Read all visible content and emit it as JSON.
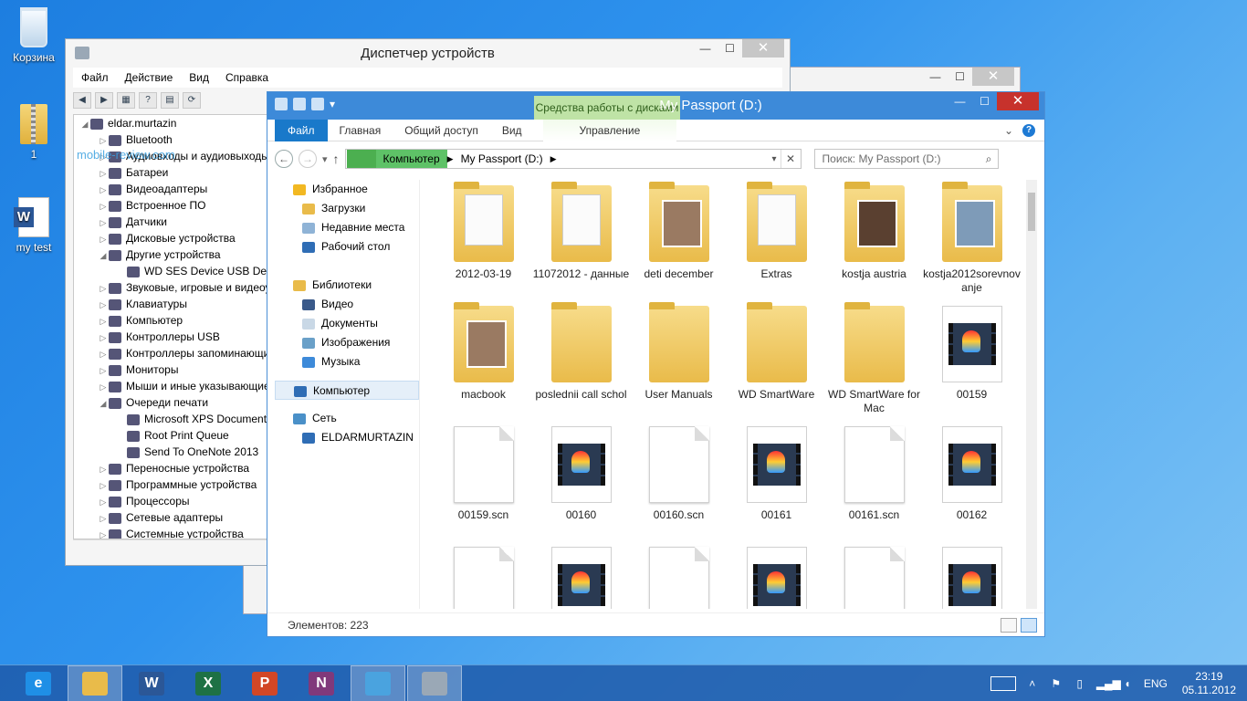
{
  "desktop": {
    "icons": [
      {
        "label": "Корзина"
      },
      {
        "label": "1"
      },
      {
        "label": "my test"
      }
    ]
  },
  "device_manager": {
    "title": "Диспетчер устройств",
    "menu": [
      "Файл",
      "Действие",
      "Вид",
      "Справка"
    ],
    "watermark": "mobile-review.com",
    "tree": [
      {
        "label": "eldar.murtazin",
        "level": 0,
        "expand": "◢"
      },
      {
        "label": "Bluetooth",
        "level": 1,
        "expand": "▷"
      },
      {
        "label": "Аудиовходы и аудиовыходы",
        "level": 1,
        "expand": "▷"
      },
      {
        "label": "Батареи",
        "level": 1,
        "expand": "▷"
      },
      {
        "label": "Видеоадаптеры",
        "level": 1,
        "expand": "▷"
      },
      {
        "label": "Встроенное ПО",
        "level": 1,
        "expand": "▷"
      },
      {
        "label": "Датчики",
        "level": 1,
        "expand": "▷"
      },
      {
        "label": "Дисковые устройства",
        "level": 1,
        "expand": "▷"
      },
      {
        "label": "Другие устройства",
        "level": 1,
        "expand": "◢"
      },
      {
        "label": "WD SES Device USB Device",
        "level": 2,
        "expand": ""
      },
      {
        "label": "Звуковые, игровые и видеоустройства",
        "level": 1,
        "expand": "▷"
      },
      {
        "label": "Клавиатуры",
        "level": 1,
        "expand": "▷"
      },
      {
        "label": "Компьютер",
        "level": 1,
        "expand": "▷"
      },
      {
        "label": "Контроллеры USB",
        "level": 1,
        "expand": "▷"
      },
      {
        "label": "Контроллеры запоминающих устройств",
        "level": 1,
        "expand": "▷"
      },
      {
        "label": "Мониторы",
        "level": 1,
        "expand": "▷"
      },
      {
        "label": "Мыши и иные указывающие устройства",
        "level": 1,
        "expand": "▷"
      },
      {
        "label": "Очереди печати",
        "level": 1,
        "expand": "◢"
      },
      {
        "label": "Microsoft XPS Document Writer",
        "level": 2,
        "expand": ""
      },
      {
        "label": "Root Print Queue",
        "level": 2,
        "expand": ""
      },
      {
        "label": "Send To OneNote 2013",
        "level": 2,
        "expand": ""
      },
      {
        "label": "Переносные устройства",
        "level": 1,
        "expand": "▷"
      },
      {
        "label": "Программные устройства",
        "level": 1,
        "expand": "▷"
      },
      {
        "label": "Процессоры",
        "level": 1,
        "expand": "▷"
      },
      {
        "label": "Сетевые адаптеры",
        "level": 1,
        "expand": "▷"
      },
      {
        "label": "Системные устройства",
        "level": 1,
        "expand": "▷"
      }
    ]
  },
  "explorer": {
    "title": "My Passport (D:)",
    "context_group": "Средства работы с дисками",
    "ribbon_tabs": {
      "file": "Файл",
      "home": "Главная",
      "share": "Общий доступ",
      "view": "Вид",
      "manage": "Управление"
    },
    "address": {
      "crumb1": "Компьютер",
      "crumb2": "My Passport (D:)"
    },
    "search_placeholder": "Поиск: My Passport (D:)",
    "nav": {
      "favorites": "Избранное",
      "downloads": "Загрузки",
      "recent": "Недавние места",
      "desktop": "Рабочий стол",
      "libraries": "Библиотеки",
      "video": "Видео",
      "documents": "Документы",
      "images": "Изображения",
      "music": "Музыка",
      "computer": "Компьютер",
      "network": "Сеть",
      "pc": "ELDARMURTAZIN"
    },
    "files": [
      {
        "name": "2012-03-19",
        "kind": "folder-paper"
      },
      {
        "name": "11072012 - данные",
        "kind": "folder-paper"
      },
      {
        "name": "deti december",
        "kind": "folder-photo"
      },
      {
        "name": "Extras",
        "kind": "folder-paper"
      },
      {
        "name": "kostja austria",
        "kind": "folder-photo"
      },
      {
        "name": "kostja2012sorevnovanje",
        "kind": "folder-photo"
      },
      {
        "name": "macbook",
        "kind": "folder-photo"
      },
      {
        "name": "poslednii call schol",
        "kind": "folder"
      },
      {
        "name": "User Manuals",
        "kind": "folder"
      },
      {
        "name": "WD SmartWare",
        "kind": "folder"
      },
      {
        "name": "WD SmartWare for Mac",
        "kind": "folder"
      },
      {
        "name": "00159",
        "kind": "video"
      },
      {
        "name": "00159.scn",
        "kind": "doc"
      },
      {
        "name": "00160",
        "kind": "video"
      },
      {
        "name": "00160.scn",
        "kind": "doc"
      },
      {
        "name": "00161",
        "kind": "video"
      },
      {
        "name": "00161.scn",
        "kind": "doc"
      },
      {
        "name": "00162",
        "kind": "video"
      },
      {
        "name": "",
        "kind": "doc"
      },
      {
        "name": "",
        "kind": "video"
      },
      {
        "name": "",
        "kind": "doc"
      },
      {
        "name": "",
        "kind": "video"
      },
      {
        "name": "",
        "kind": "doc"
      },
      {
        "name": "",
        "kind": "video"
      }
    ],
    "status": "Элементов: 223"
  },
  "taskbar": {
    "apps": [
      {
        "name": "ie",
        "glyph": "e",
        "color": "#1f8fe6"
      },
      {
        "name": "explorer",
        "glyph": "",
        "color": "#e9bb4a"
      },
      {
        "name": "word",
        "glyph": "W",
        "color": "#2b5797"
      },
      {
        "name": "excel",
        "glyph": "X",
        "color": "#1e7145"
      },
      {
        "name": "powerpoint",
        "glyph": "P",
        "color": "#d24726"
      },
      {
        "name": "onenote",
        "glyph": "N",
        "color": "#80397b"
      },
      {
        "name": "control-panel",
        "glyph": "",
        "color": "#4aa3df"
      },
      {
        "name": "device-manager",
        "glyph": "",
        "color": "#9aa8b6"
      }
    ],
    "lang": "ENG",
    "time": "23:19",
    "date": "05.11.2012"
  }
}
